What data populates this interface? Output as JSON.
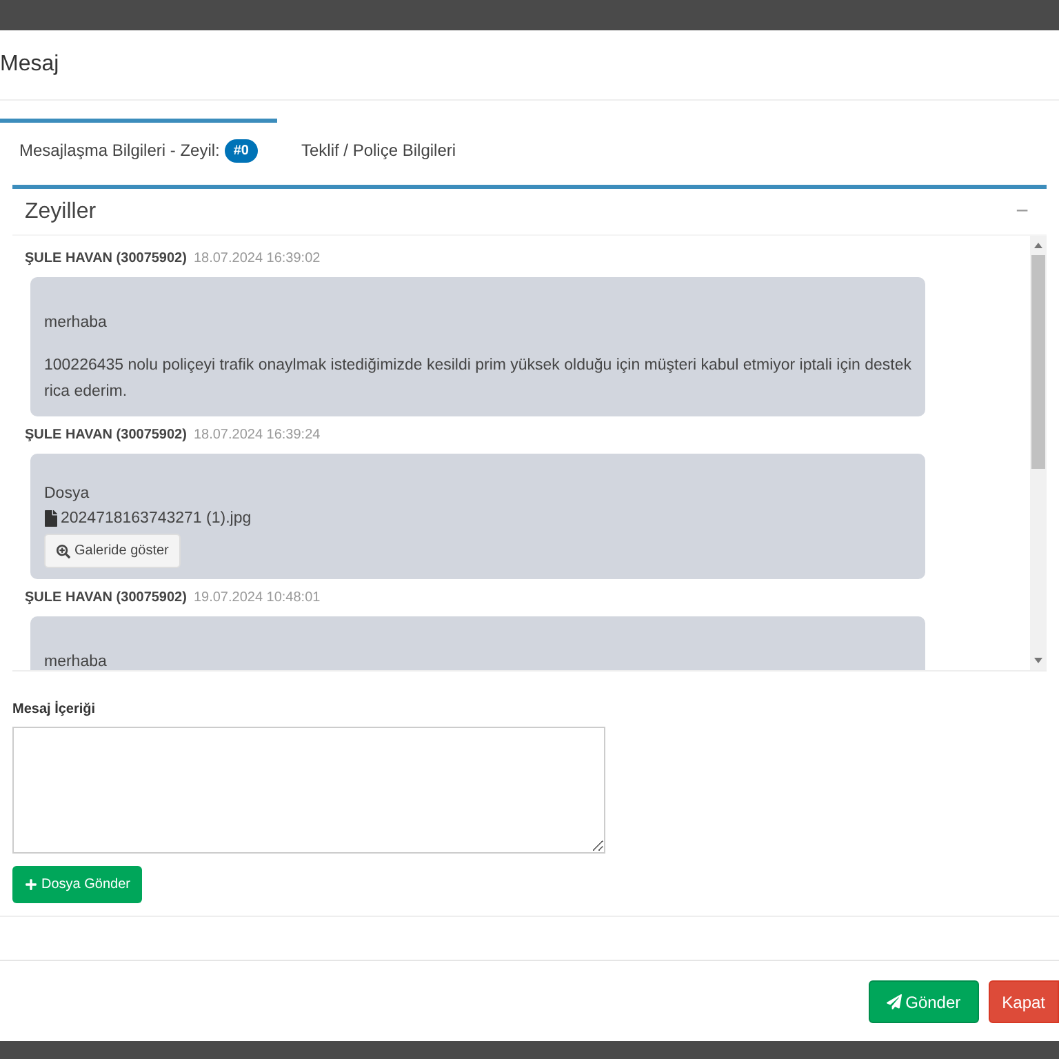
{
  "modal": {
    "title": "Mesaj"
  },
  "tabs": [
    {
      "label": "Mesajlaşma Bilgileri - Zeyil:",
      "badge": "#0",
      "selected": true
    },
    {
      "label": "Teklif / Poliçe Bilgileri",
      "selected": false
    }
  ],
  "panel": {
    "title": "Zeyiller",
    "collapse": "−"
  },
  "messages": [
    {
      "kind": "text",
      "author": "ŞULE HAVAN (30075902)",
      "time": "18.07.2024 16:39:02",
      "paragraphs": [
        "merhaba",
        "100226435 nolu poliçeyi trafik onaylmak istediğimizde kesildi prim yüksek olduğu için müşteri kabul etmiyor iptali için destek rica ederim."
      ]
    },
    {
      "kind": "file",
      "author": "ŞULE HAVAN (30075902)",
      "time": "18.07.2024 16:39:24",
      "heading": "Dosya",
      "file": "2024718163743271 (1).jpg",
      "button": "Galeride göster"
    },
    {
      "kind": "text",
      "author": "ŞULE HAVAN (30075902)",
      "time": "19.07.2024 10:48:01",
      "paragraphs": [
        "merhaba"
      ]
    }
  ],
  "form": {
    "label": "Mesaj İçeriği",
    "upload_button": "Dosya Gönder"
  },
  "footer": {
    "send_button": "Gönder",
    "close_button": "Kapat"
  }
}
